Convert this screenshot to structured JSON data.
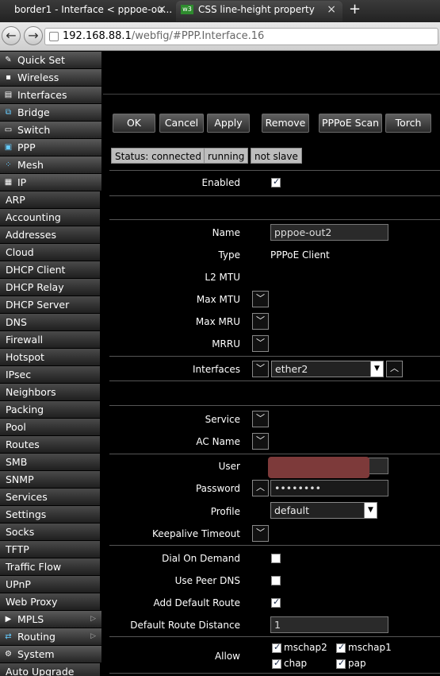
{
  "browser": {
    "tabs": [
      {
        "label": "border1 - Interface < pppoe-ou..."
      },
      {
        "label": "CSS line-height property",
        "favicon": "w3"
      }
    ],
    "url_host": "192.168.88.1",
    "url_path": "/webfig/#PPP.Interface.16"
  },
  "sidebar": {
    "items": [
      {
        "label": "Quick Set",
        "icon": "wand-icon"
      },
      {
        "label": "Wireless",
        "icon": "wireless-icon"
      },
      {
        "label": "Interfaces",
        "icon": "interfaces-icon"
      },
      {
        "label": "Bridge",
        "icon": "bridge-icon"
      },
      {
        "label": "Switch",
        "icon": "switch-icon"
      },
      {
        "label": "PPP",
        "icon": "ppp-icon"
      },
      {
        "label": "Mesh",
        "icon": "mesh-icon"
      },
      {
        "label": "IP",
        "icon": "ip-icon"
      }
    ],
    "ip_subitems": [
      "ARP",
      "Accounting",
      "Addresses",
      "Cloud",
      "DHCP Client",
      "DHCP Relay",
      "DHCP Server",
      "DNS",
      "Firewall",
      "Hotspot",
      "IPsec",
      "Neighbors",
      "Packing",
      "Pool",
      "Routes",
      "SMB",
      "SNMP",
      "Services",
      "Settings",
      "Socks",
      "TFTP",
      "Traffic Flow",
      "UPnP",
      "Web Proxy"
    ],
    "bottom_items": [
      {
        "label": "MPLS",
        "icon": "mpls-icon"
      },
      {
        "label": "Routing",
        "icon": "routing-icon"
      },
      {
        "label": "System",
        "icon": "gear-icon"
      },
      {
        "label": "Auto Upgrade"
      }
    ]
  },
  "toolbar": {
    "ok": "OK",
    "cancel": "Cancel",
    "apply": "Apply",
    "remove": "Remove",
    "pppoe_scan": "PPPoE Scan",
    "torch": "Torch"
  },
  "status": {
    "state": "Status: connected",
    "running": "running",
    "slave": "not slave"
  },
  "form": {
    "enabled_label": "Enabled",
    "enabled": true,
    "name_label": "Name",
    "name_value": "pppoe-out2",
    "type_label": "Type",
    "type_value": "PPPoE Client",
    "l2mtu_label": "L2 MTU",
    "max_mtu_label": "Max MTU",
    "max_mru_label": "Max MRU",
    "mrru_label": "MRRU",
    "interfaces_label": "Interfaces",
    "interfaces_value": "ether2",
    "service_label": "Service",
    "ac_name_label": "AC Name",
    "user_label": "User",
    "password_label": "Password",
    "password_value": "••••••••",
    "profile_label": "Profile",
    "profile_value": "default",
    "keepalive_label": "Keepalive Timeout",
    "dial_on_demand_label": "Dial On Demand",
    "dial_on_demand": false,
    "use_peer_dns_label": "Use Peer DNS",
    "use_peer_dns": false,
    "add_default_route_label": "Add Default Route",
    "add_default_route": true,
    "default_route_distance_label": "Default Route Distance",
    "default_route_distance_value": "1",
    "allow_label": "Allow",
    "allow": [
      {
        "label": "mschap2",
        "checked": true
      },
      {
        "label": "mschap1",
        "checked": true
      },
      {
        "label": "chap",
        "checked": true
      },
      {
        "label": "pap",
        "checked": true
      }
    ]
  }
}
